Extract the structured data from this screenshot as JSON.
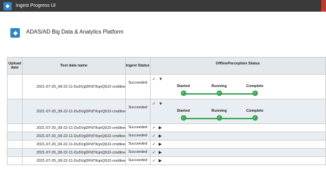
{
  "window": {
    "title": "Ingest Progress UI"
  },
  "header": {
    "title": "ADAS/AD Big Data & Analytics Platform"
  },
  "table": {
    "columns": {
      "upload_date": "Upload date",
      "test_name": "Test data name",
      "ingest_status": "Ingest Status",
      "perception_status": "OfflinePerception Status"
    },
    "steps": [
      "Started",
      "Running",
      "Complete"
    ],
    "rows": [
      {
        "name": "2021-07-20_08-22-11-Du5VgDPdTKqnQ9J2-cmdline-tool",
        "ingest": "Succeeded"
      },
      {
        "name": "2021-07-20_08-22-11-Du5VgDPdTKqnQ9J2-cmdline-tool",
        "ingest": "Succeeded"
      },
      {
        "name": "2021-07-20_08-22-11-Du5VgDPdTKqnQ9J2-cmdline-tool",
        "ingest": "Succeeded"
      },
      {
        "name": "2021-07-20_08-22-11-Du5VgDPdTKqnQ9J2-cmdline-tool",
        "ingest": "Succeeded"
      },
      {
        "name": "2021-07-20_08-22-11-Du5VgDPdTKqnQ9J2-cmdline-tool",
        "ingest": "Succeeded"
      },
      {
        "name": "2021-07-20_08-22-11-Du5VgDPdTKqnQ9J2-cmdline-tool",
        "ingest": "Succeeded"
      },
      {
        "name": "2021-07-20_08-22-11-Du5VgDPdTKqnQ9J2-cmdline-tool",
        "ingest": "Succeeded"
      }
    ]
  },
  "icons": {
    "check": "✓",
    "expand": "▼",
    "collapse": "▶",
    "step_done": "✓"
  },
  "colors": {
    "titlebar": "#3a3a3a",
    "accent": "#2f86c6",
    "success": "#3aa455",
    "header_bg": "#e3e8ec",
    "row_alt": "#e9eef2"
  }
}
